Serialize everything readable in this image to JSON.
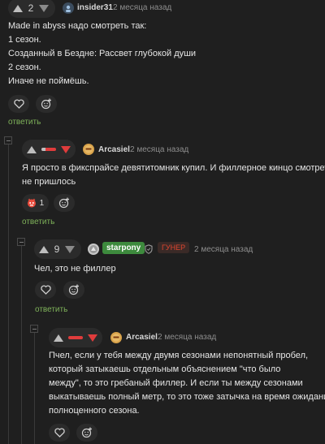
{
  "comments": [
    {
      "rating": "2",
      "username": "insider31",
      "date": "2 месяца назад",
      "lines": [
        "Made in abyss надо смотреть так:",
        "1 сезон.",
        "Созданный в Бездне: Рассвет глубокой души",
        "2 сезон.",
        "Иначе не поймёшь."
      ],
      "reply_label": "ответить"
    },
    {
      "username": "Arcasiel",
      "date": "2 месяца назад",
      "lines": [
        "Я просто в фикспрайсе девятитомник купил. И филлерное кинцо смотреть",
        "не пришлось"
      ],
      "reaction_count": "1",
      "reply_label": "ответить"
    },
    {
      "rating": "9",
      "username": "starpony",
      "badge": "ГУНЕР",
      "date": "2 месяца назад",
      "lines": [
        "Чел, это не филлер"
      ],
      "reply_label": "ответить"
    },
    {
      "username": "Arcasiel",
      "date": "2 месяца назад",
      "lines": [
        "Пчел, если у тебя между двумя сезонами непонятный пробел,",
        "который затыкаешь отдельным объяснением \"что было",
        "между\", то это гребаный филлер. И если ты между сезонами",
        "выкатываешь полный метр, то это тоже затычка на время ожидания",
        "полноценного сезона."
      ]
    }
  ],
  "colors": {
    "background": "#1f1f1f",
    "reply_link": "#7fb35a",
    "downvote_active": "#e03c3c",
    "badge_text": "#e0452f",
    "username_tag_bg": "#3d8a3d"
  },
  "vote_ratios": {
    "comment2_positive_share": 0.3,
    "comment4_positive_share": 0.0
  }
}
